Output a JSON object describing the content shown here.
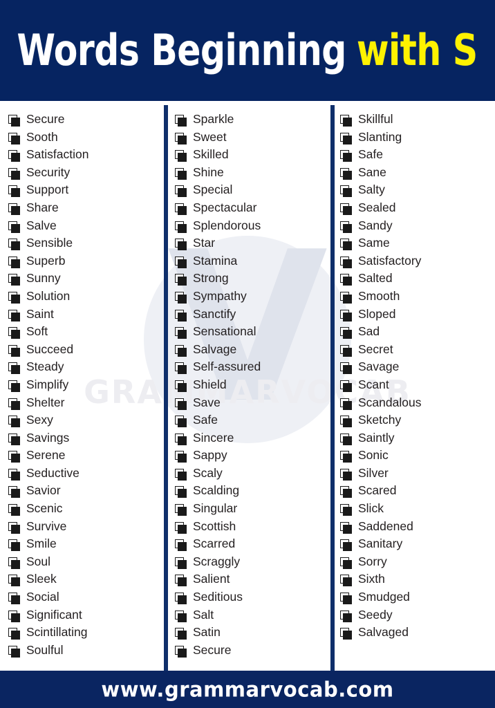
{
  "header": {
    "title_part1": "Words  Beginning",
    "title_part2": "with S",
    "background_color": "#062461",
    "text_color_primary": "#ffffff",
    "text_color_accent": "#fff200"
  },
  "watermark": {
    "logo_letter": "V",
    "brand_text": "GRAMMARVOCAB"
  },
  "footer": {
    "url": "www.grammarvocab.com",
    "background_color": "#0a2561",
    "text_color": "#ffffff"
  },
  "columns": [
    {
      "id": "column-1",
      "words": [
        "Secure",
        "Sooth",
        "Satisfaction",
        "Security",
        "Support",
        "Share",
        "Salve",
        "Sensible",
        "Superb",
        "Sunny",
        "Solution",
        "Saint",
        "Soft",
        "Succeed",
        "Steady",
        "Simplify",
        "Shelter",
        "Sexy",
        "Savings",
        "Serene",
        "Seductive",
        "Savior",
        "Scenic",
        "Survive",
        "Smile",
        "Soul",
        "Sleek",
        "Social",
        "Significant",
        "Scintillating",
        "Soulful"
      ]
    },
    {
      "id": "column-2",
      "words": [
        "Sparkle",
        "Sweet",
        "Skilled",
        "Shine",
        "Special",
        "Spectacular",
        "Splendorous",
        "Star",
        "Stamina",
        "Strong",
        "Sympathy",
        "Sanctify",
        "Sensational",
        "Salvage",
        "Self-assured",
        "Shield",
        "Save",
        "Safe",
        "Sincere",
        "Sappy",
        "Scaly",
        "Scalding",
        "Singular",
        "Scottish",
        "Scarred",
        "Scraggly",
        "Salient",
        "Seditious",
        "Salt",
        "Satin",
        "Secure"
      ]
    },
    {
      "id": "column-3",
      "words": [
        "Skillful",
        "Slanting",
        "Safe",
        "Sane",
        "Salty",
        "Sealed",
        "Sandy",
        "Same",
        "Satisfactory",
        "Salted",
        "Smooth",
        "Sloped",
        "Sad",
        "Secret",
        "Savage",
        "Scant",
        "Scandalous",
        "Sketchy",
        "Saintly",
        "Sonic",
        "Silver",
        "Scared",
        "Slick",
        "Saddened",
        "Sanitary",
        "Sorry",
        "Sixth",
        "Smudged",
        "Seedy",
        "Salvaged"
      ]
    }
  ]
}
